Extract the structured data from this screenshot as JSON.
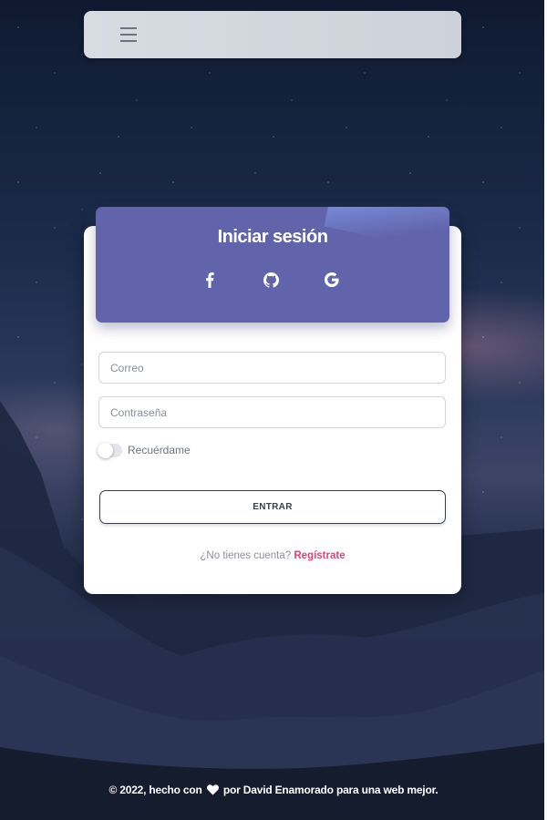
{
  "navbar": {
    "menu_icon": "hamburger-menu-icon"
  },
  "login": {
    "title": "Iniciar sesión",
    "social": [
      {
        "icon": "facebook-icon"
      },
      {
        "icon": "github-icon"
      },
      {
        "icon": "google-icon"
      }
    ],
    "email_placeholder": "Correo",
    "password_placeholder": "Contraseña",
    "remember_label": "Recuérdame",
    "submit_label": "ENTRAR",
    "no_account_text": "¿No tienes cuenta?",
    "register_link": "Regístrate"
  },
  "footer": {
    "prefix": "© 2022, hecho con",
    "heart_icon": "heart-icon",
    "suffix": "por David Enamorado para una web mejor."
  },
  "colors": {
    "header_bg": "#6164aa",
    "link": "#e5407a",
    "navbar_bg": "#d7dbe2"
  }
}
